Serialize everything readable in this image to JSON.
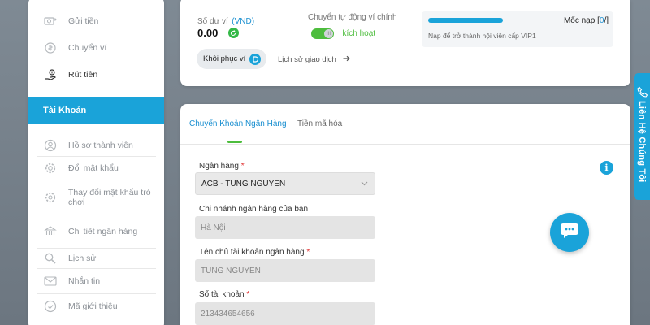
{
  "sidebar": {
    "items_top": [
      {
        "label": "Gửi tiền",
        "icon": "deposit-icon"
      },
      {
        "label": "Chuyển ví",
        "icon": "transfer-wallet-icon"
      },
      {
        "label": "Rút tiền",
        "icon": "withdraw-icon"
      }
    ],
    "section_title": "Tài Khoản",
    "items_account": [
      {
        "label": "Hồ sơ thành viên",
        "icon": "profile-icon"
      },
      {
        "label": "Đổi mật khẩu",
        "icon": "gear-icon"
      },
      {
        "label": "Thay đổi mật khẩu trò chơi",
        "icon": "game-password-icon"
      },
      {
        "label": "Chi tiết ngân hàng",
        "icon": "bank-icon"
      },
      {
        "label": "Lịch sử",
        "icon": "search-icon"
      },
      {
        "label": "Nhắn tin",
        "icon": "mail-icon"
      },
      {
        "label": "Mã giới thiệu",
        "icon": "referral-icon"
      }
    ]
  },
  "wallet": {
    "balance_label": "Số dư ví",
    "currency_label": "(VND)",
    "balance_value": "0.00",
    "auto_transfer_label": "Chuyển tự động ví chính",
    "toggle_state_label": "kích hoạt",
    "toggle_knob_text": "III",
    "toggle_on": true,
    "restore_button": "Khôi phục ví",
    "history_link": "Lịch sử giao dịch"
  },
  "vip": {
    "progress_fraction": 0.42,
    "deposit_label": "Mốc nạp",
    "deposit_value_open": "[",
    "deposit_value": "0",
    "deposit_value_close": "/]",
    "note": "Nạp để trở thành hội viên cấp VIP1"
  },
  "tabs": [
    {
      "label": "Chuyển Khoản Ngân Hàng",
      "active": true
    },
    {
      "label": "Tiền mã hóa",
      "active": false
    }
  ],
  "form": {
    "bank_label": "Ngân hàng",
    "bank_value": "ACB - TUNG NGUYEN",
    "branch_label": "Chi nhánh ngân hàng của bạn",
    "branch_value": "Hà Nội",
    "holder_label": "Tên chủ tài khoản ngân hàng",
    "holder_value": "TUNG NGUYEN",
    "account_label": "Số tài khoản",
    "account_value": "213434654656",
    "required_mark": "*"
  },
  "contact_tab_label": "Liên Hệ Chúng Tôi",
  "colors": {
    "accent": "#1aa3d9",
    "toggle_green": "#4dbd3d",
    "link_blue": "#1a8fd0"
  }
}
